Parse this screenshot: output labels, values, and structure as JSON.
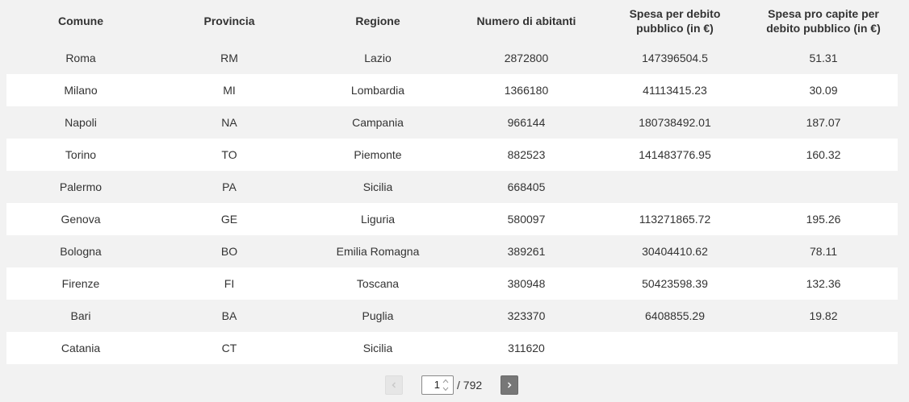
{
  "table": {
    "headers": [
      "Comune",
      "Provincia",
      "Regione",
      "Numero di abitanti",
      "Spesa per debito pubblico (in €)",
      "Spesa pro capite per debito pubblico (in €)"
    ],
    "rows": [
      [
        "Roma",
        "RM",
        "Lazio",
        "2872800",
        "147396504.5",
        "51.31"
      ],
      [
        "Milano",
        "MI",
        "Lombardia",
        "1366180",
        "41113415.23",
        "30.09"
      ],
      [
        "Napoli",
        "NA",
        "Campania",
        "966144",
        "180738492.01",
        "187.07"
      ],
      [
        "Torino",
        "TO",
        "Piemonte",
        "882523",
        "141483776.95",
        "160.32"
      ],
      [
        "Palermo",
        "PA",
        "Sicilia",
        "668405",
        "",
        ""
      ],
      [
        "Genova",
        "GE",
        "Liguria",
        "580097",
        "113271865.72",
        "195.26"
      ],
      [
        "Bologna",
        "BO",
        "Emilia Romagna",
        "389261",
        "30404410.62",
        "78.11"
      ],
      [
        "Firenze",
        "FI",
        "Toscana",
        "380948",
        "50423598.39",
        "132.36"
      ],
      [
        "Bari",
        "BA",
        "Puglia",
        "323370",
        "6408855.29",
        "19.82"
      ],
      [
        "Catania",
        "CT",
        "Sicilia",
        "311620",
        "",
        ""
      ]
    ]
  },
  "pagination": {
    "current_page": "1",
    "total_label": "/ 792",
    "prev_icon": "chevron-left-icon",
    "next_icon": "chevron-right-icon"
  }
}
